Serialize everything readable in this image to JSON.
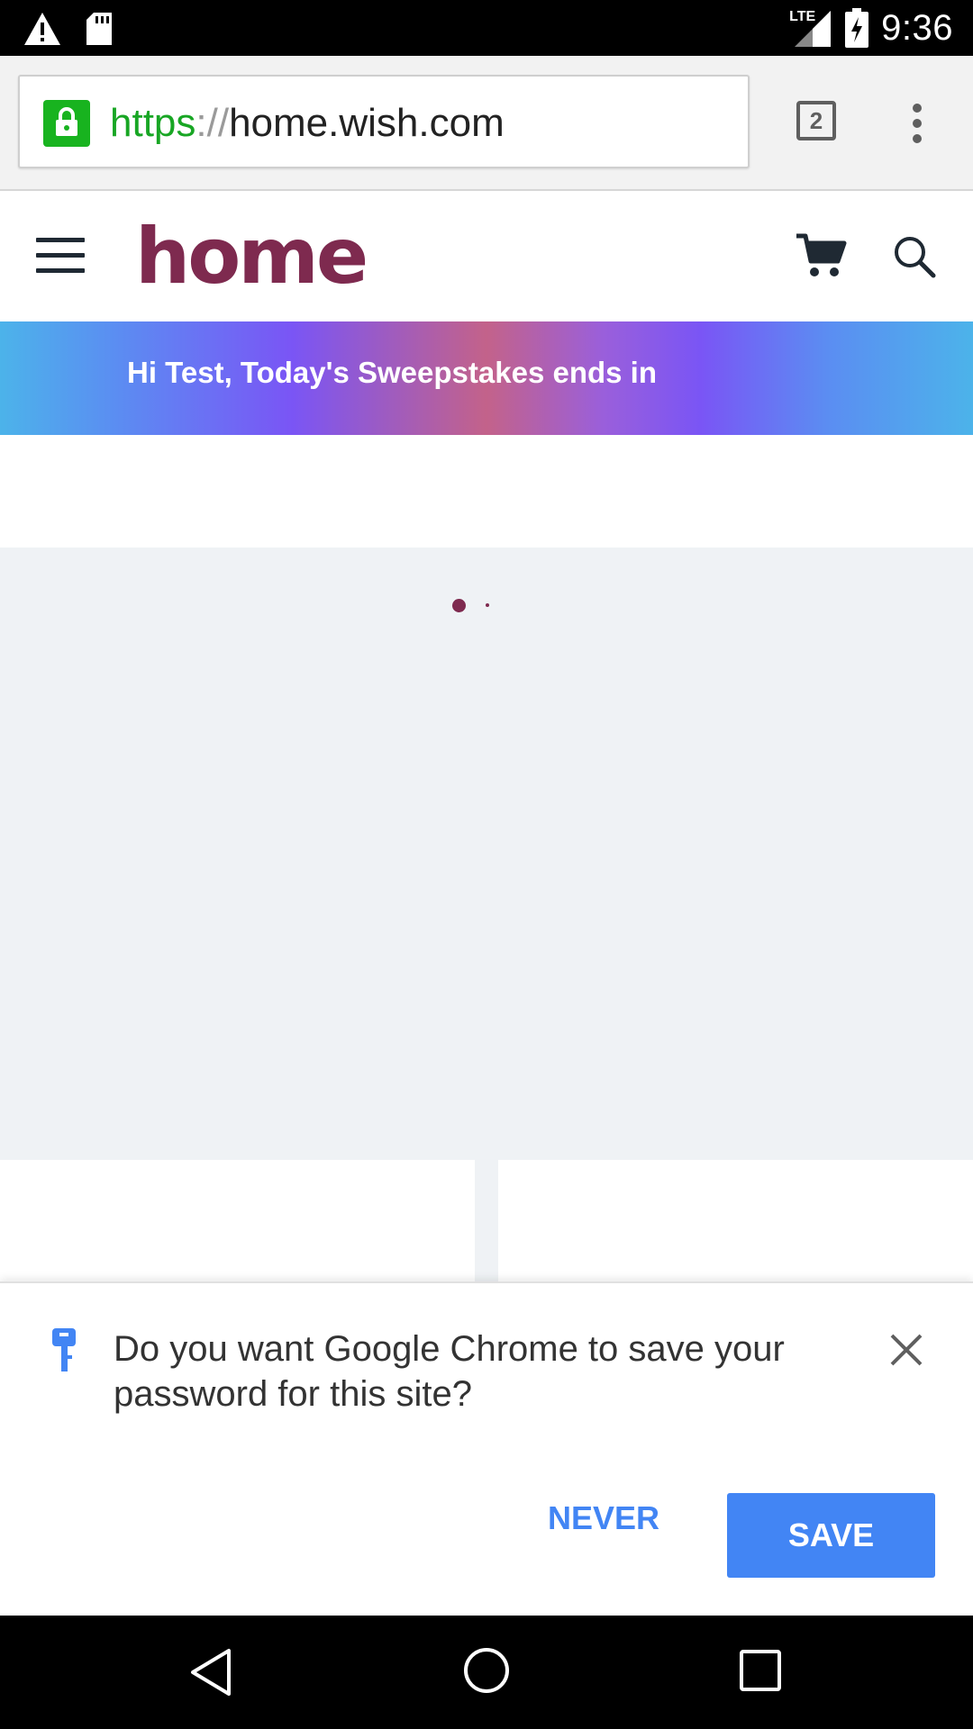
{
  "status_bar": {
    "network_label": "LTE",
    "time": "9:36"
  },
  "browser": {
    "url_scheme": "https",
    "url_separator": "://",
    "url_host": "home.wish.com",
    "tab_count": "2"
  },
  "site": {
    "logo_text": "home",
    "banner_text": "Hi Test, Today's Sweepstakes ends in",
    "brand_color": "#7e2a4f"
  },
  "infobar": {
    "message": "Do you want Google Chrome to save your password for this site?",
    "never_label": "NEVER",
    "save_label": "SAVE",
    "accent_color": "#4285f4"
  },
  "icons": {
    "status_left": [
      "warning-icon",
      "sd-card-icon"
    ],
    "status_right": [
      "signal-icon",
      "battery-charging-icon"
    ],
    "toolbar": [
      "lock-icon",
      "tab-switcher-icon",
      "overflow-menu-icon"
    ],
    "header": [
      "hamburger-menu-icon",
      "cart-icon",
      "search-icon"
    ],
    "infobar": [
      "key-icon",
      "close-icon"
    ],
    "nav": [
      "back-icon",
      "home-icon",
      "recents-icon"
    ]
  }
}
